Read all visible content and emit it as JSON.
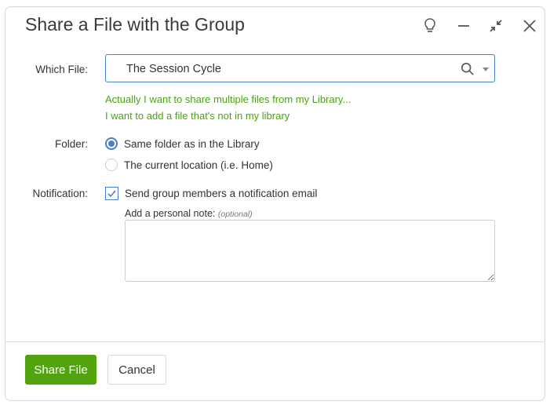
{
  "dialog": {
    "title": "Share a File with the Group",
    "header_icons": [
      "lightbulb-icon",
      "minimize-icon",
      "collapse-icon",
      "close-icon"
    ]
  },
  "form": {
    "which_file": {
      "label": "Which File:",
      "value": "The Session Cycle"
    },
    "links": [
      "Actually I want to share multiple files from my Library...",
      "I want to add a file that's not in my library"
    ],
    "folder": {
      "label": "Folder:",
      "options": [
        {
          "label": "Same folder as in the Library",
          "selected": true
        },
        {
          "label": "The current location (i.e. Home)",
          "selected": false
        }
      ]
    },
    "notification": {
      "label": "Notification:",
      "checkbox_label": "Send group members a notification email",
      "checked": true,
      "note_label": "Add a personal note:",
      "note_hint": "(optional)",
      "note_value": ""
    }
  },
  "footer": {
    "primary_label": "Share File",
    "secondary_label": "Cancel"
  },
  "colors": {
    "accent_green": "#52a40f",
    "link_green": "#4aa312",
    "focus_blue": "#4a80c8"
  }
}
